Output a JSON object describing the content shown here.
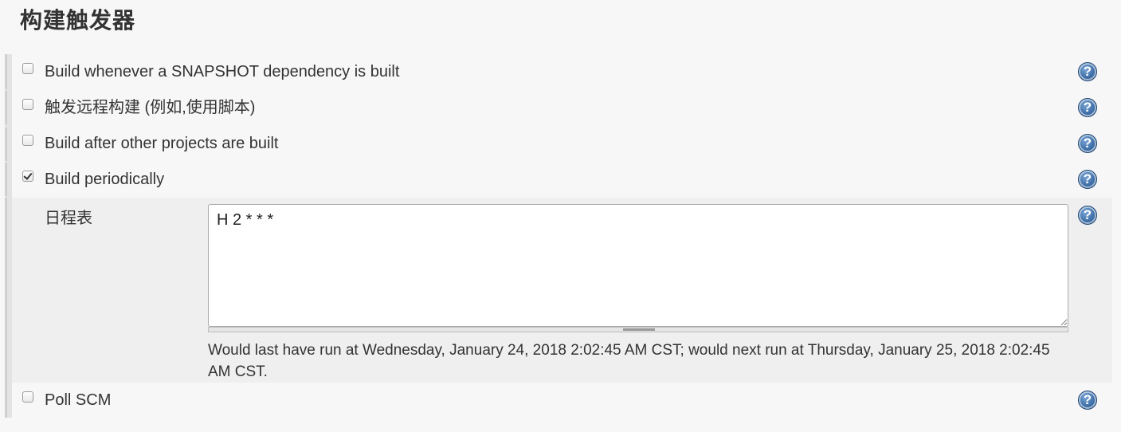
{
  "section": {
    "title": "构建触发器"
  },
  "triggers": [
    {
      "label": "Build whenever a SNAPSHOT dependency is built",
      "checked": false
    },
    {
      "label": "触发远程构建 (例如,使用脚本)",
      "checked": false
    },
    {
      "label": "Build after other projects are built",
      "checked": false
    },
    {
      "label": "Build periodically",
      "checked": true
    },
    {
      "label": "Poll SCM",
      "checked": false
    }
  ],
  "schedule": {
    "label": "日程表",
    "value": "H 2 * * *",
    "info": "Would last have run at Wednesday, January 24, 2018 2:02:45 AM CST; would next run at Thursday, January 25, 2018 2:02:45 AM CST."
  },
  "help": {
    "glyph": "?",
    "color": "#3e6fa8"
  }
}
